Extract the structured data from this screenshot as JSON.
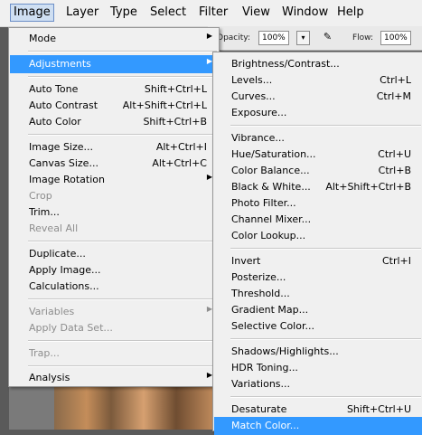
{
  "menubar": {
    "items": [
      "Image",
      "Layer",
      "Type",
      "Select",
      "Filter",
      "View",
      "Window",
      "Help"
    ]
  },
  "options_bar": {
    "opacity_label": "Opacity:",
    "opacity_value": "100%",
    "flow_label": "Flow:",
    "flow_value": "100%"
  },
  "image_menu": {
    "mode": "Mode",
    "adjustments": "Adjustments",
    "auto_tone": {
      "label": "Auto Tone",
      "shortcut": "Shift+Ctrl+L"
    },
    "auto_contrast": {
      "label": "Auto Contrast",
      "shortcut": "Alt+Shift+Ctrl+L"
    },
    "auto_color": {
      "label": "Auto Color",
      "shortcut": "Shift+Ctrl+B"
    },
    "image_size": {
      "label": "Image Size...",
      "shortcut": "Alt+Ctrl+I"
    },
    "canvas_size": {
      "label": "Canvas Size...",
      "shortcut": "Alt+Ctrl+C"
    },
    "image_rotation": "Image Rotation",
    "crop": "Crop",
    "trim": "Trim...",
    "reveal_all": "Reveal All",
    "duplicate": "Duplicate...",
    "apply_image": "Apply Image...",
    "calculations": "Calculations...",
    "variables": "Variables",
    "apply_data_set": "Apply Data Set...",
    "trap": "Trap...",
    "analysis": "Analysis"
  },
  "adjustments_menu": {
    "brightness_contrast": {
      "label": "Brightness/Contrast...",
      "shortcut": ""
    },
    "levels": {
      "label": "Levels...",
      "shortcut": "Ctrl+L"
    },
    "curves": {
      "label": "Curves...",
      "shortcut": "Ctrl+M"
    },
    "exposure": {
      "label": "Exposure...",
      "shortcut": ""
    },
    "vibrance": {
      "label": "Vibrance...",
      "shortcut": ""
    },
    "hue_saturation": {
      "label": "Hue/Saturation...",
      "shortcut": "Ctrl+U"
    },
    "color_balance": {
      "label": "Color Balance...",
      "shortcut": "Ctrl+B"
    },
    "black_white": {
      "label": "Black & White...",
      "shortcut": "Alt+Shift+Ctrl+B"
    },
    "photo_filter": {
      "label": "Photo Filter...",
      "shortcut": ""
    },
    "channel_mixer": {
      "label": "Channel Mixer...",
      "shortcut": ""
    },
    "color_lookup": {
      "label": "Color Lookup...",
      "shortcut": ""
    },
    "invert": {
      "label": "Invert",
      "shortcut": "Ctrl+I"
    },
    "posterize": {
      "label": "Posterize...",
      "shortcut": ""
    },
    "threshold": {
      "label": "Threshold...",
      "shortcut": ""
    },
    "gradient_map": {
      "label": "Gradient Map...",
      "shortcut": ""
    },
    "selective_color": {
      "label": "Selective Color...",
      "shortcut": ""
    },
    "shadows_highlights": {
      "label": "Shadows/Highlights...",
      "shortcut": ""
    },
    "hdr_toning": {
      "label": "HDR Toning...",
      "shortcut": ""
    },
    "variations": {
      "label": "Variations...",
      "shortcut": ""
    },
    "desaturate": {
      "label": "Desaturate",
      "shortcut": "Shift+Ctrl+U"
    },
    "match_color": {
      "label": "Match Color...",
      "shortcut": ""
    }
  },
  "colors": {
    "highlight": "#3399ff",
    "menu_bg": "#f0f0f0",
    "disabled_text": "#8d8d8d"
  }
}
